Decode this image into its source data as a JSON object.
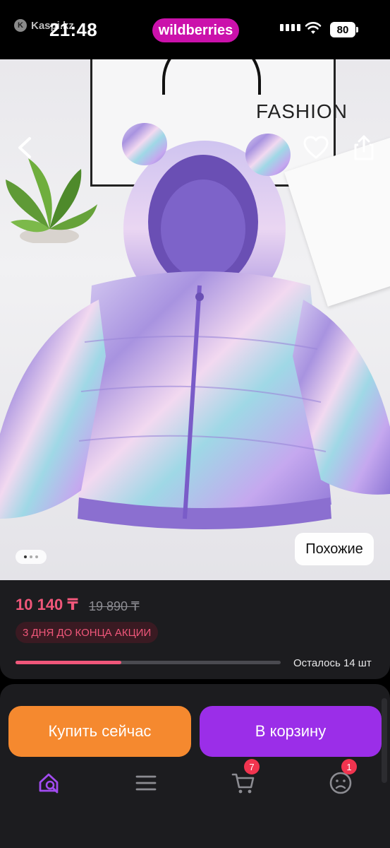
{
  "status_bar": {
    "carrier_app": "Kaspi.kz",
    "time": "21:48",
    "battery": "80"
  },
  "brand": {
    "logo_text": "wildberries",
    "color": "#cb11ab"
  },
  "photo": {
    "bag_text": "FASHION",
    "similar_label": "Похожие",
    "slide_count": 3,
    "active_slide": 1
  },
  "product": {
    "price": "10 140 ₸",
    "old_price": "19 890 ₸",
    "promo_label": "3 ДНЯ ДО КОНЦА АКЦИИ",
    "stock_label": "Осталось 14 шт",
    "stock_progress": 0.4
  },
  "actions": {
    "buy_now": "Купить сейчас",
    "add_to_cart": "В корзину"
  },
  "tabbar": {
    "items": [
      {
        "icon": "home-search-icon"
      },
      {
        "icon": "menu-icon"
      },
      {
        "icon": "cart-icon",
        "badge": "7"
      },
      {
        "icon": "profile-icon",
        "badge": "1"
      }
    ]
  },
  "colors": {
    "accent_pink": "#f0577a",
    "buy_orange": "#f5892f",
    "cart_purple": "#9b2ee8"
  }
}
